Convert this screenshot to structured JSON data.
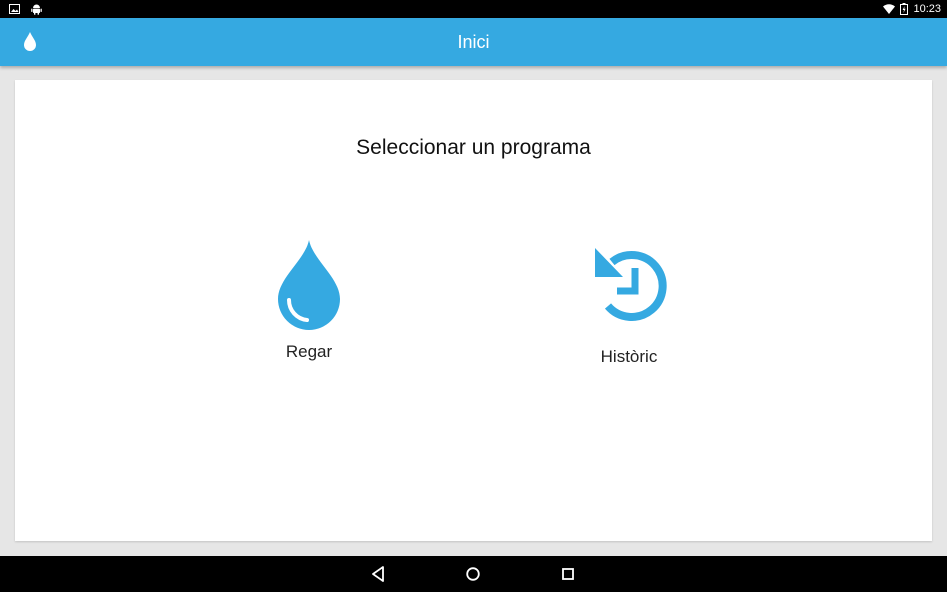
{
  "status_bar": {
    "time": "10:23",
    "icons_left": [
      "image-icon",
      "android-icon"
    ],
    "icons_right": [
      "wifi-icon",
      "battery-icon"
    ]
  },
  "app_bar": {
    "title": "Inici",
    "icon": "water-drop-icon",
    "color": "#35a9e1"
  },
  "main": {
    "heading": "Seleccionar un programa",
    "options": [
      {
        "label": "Regar",
        "icon": "water-drop-icon"
      },
      {
        "label": "Històric",
        "icon": "history-icon"
      }
    ]
  },
  "nav_bar": {
    "buttons": [
      "back-icon",
      "home-icon",
      "recents-icon"
    ]
  },
  "colors": {
    "accent": "#35a9e1",
    "background": "#e6e6e6",
    "card": "#ffffff"
  }
}
